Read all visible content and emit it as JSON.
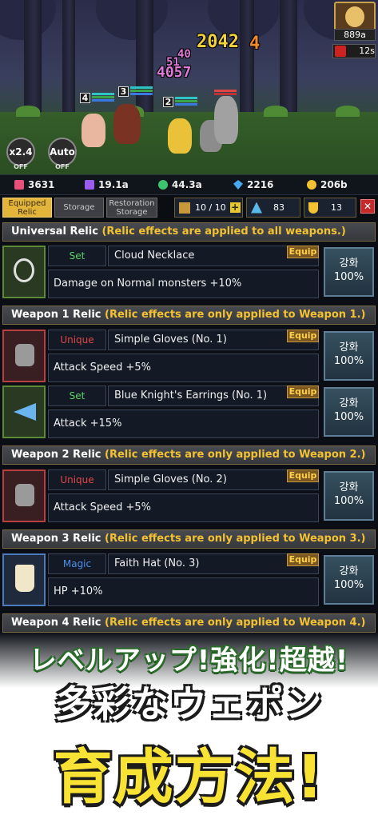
{
  "scene": {
    "damage_numbers": [
      "2042",
      "4",
      "40",
      "51",
      "4057"
    ],
    "hero_levels": [
      "4",
      "3",
      "2"
    ],
    "speed_button": {
      "label": "x2.4",
      "sub": "OFF"
    },
    "auto_button": {
      "label": "Auto",
      "sub": "OFF"
    },
    "gold_display": "889a",
    "timer": "12s"
  },
  "resources": [
    {
      "icon": "pink-gem-icon",
      "color": "#e8507a",
      "value": "3631"
    },
    {
      "icon": "purple-crystal-icon",
      "color": "#9b5cf0",
      "value": "19.1a"
    },
    {
      "icon": "green-orb-icon",
      "color": "#3cc46e",
      "value": "44.3a"
    },
    {
      "icon": "blue-diamond-icon",
      "color": "#4aa8f0",
      "value": "2216"
    },
    {
      "icon": "gold-coin-icon",
      "color": "#f2c232",
      "value": "206b"
    }
  ],
  "tabs": {
    "equipped": [
      "Equipped",
      "Relic"
    ],
    "storage": "Storage",
    "restoration": [
      "Restoration",
      "Storage"
    ],
    "slots": "10 / 10",
    "shards": "83",
    "trophies": "13"
  },
  "sections": [
    {
      "title": "Universal Relic",
      "desc": "(Relic effects are applied to all weapons.)",
      "items": [
        {
          "grade": "Set",
          "grade_color": "#5ad26a",
          "name": "Cloud Necklace",
          "effect": "Damage on Normal monsters +10%",
          "equip": "Equip",
          "upg": "강화",
          "pct": "100%"
        }
      ]
    },
    {
      "title": "Weapon 1 Relic",
      "desc": "(Relic effects are only applied to Weapon 1.)",
      "items": [
        {
          "grade": "Unique",
          "grade_color": "#e04646",
          "name": "Simple Gloves (No. 1)",
          "effect": "Attack Speed +5%",
          "equip": "Equip",
          "upg": "강화",
          "pct": "100%"
        },
        {
          "grade": "Set",
          "grade_color": "#5ad26a",
          "name": "Blue Knight's Earrings (No. 1)",
          "effect": "Attack +15%",
          "equip": "Equip",
          "upg": "강화",
          "pct": "100%"
        }
      ]
    },
    {
      "title": "Weapon 2 Relic",
      "desc": "(Relic effects are only applied to Weapon 2.)",
      "items": [
        {
          "grade": "Unique",
          "grade_color": "#e04646",
          "name": "Simple Gloves (No. 2)",
          "effect": "Attack Speed +5%",
          "equip": "Equip",
          "upg": "강화",
          "pct": "100%"
        }
      ]
    },
    {
      "title": "Weapon 3 Relic",
      "desc": "(Relic effects are only applied to Weapon 3.)",
      "items": [
        {
          "grade": "Magic",
          "grade_color": "#4d8fe8",
          "name": "Faith Hat (No. 3)",
          "effect": "HP +10%",
          "equip": "Equip",
          "upg": "강화",
          "pct": "100%"
        }
      ]
    },
    {
      "title": "Weapon 4 Relic",
      "desc": "(Relic effects are only applied to Weapon 4.)",
      "items": []
    }
  ],
  "promo": {
    "line1": "レベルアップ!強化!超越!",
    "line2": "多彩なウェポン",
    "line3": "育成方法!"
  }
}
